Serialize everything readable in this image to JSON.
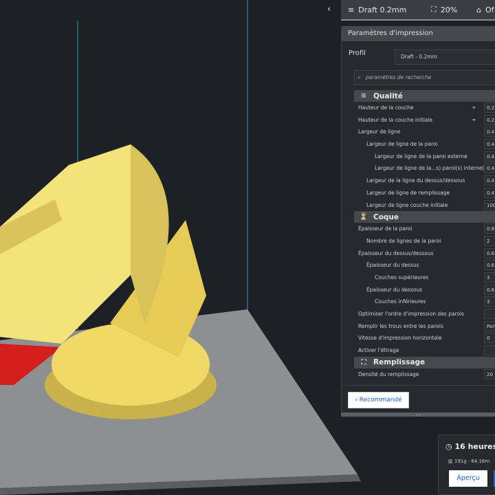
{
  "topbar": {
    "profile": "Draft 0.2mm",
    "infill": "20%",
    "support": "Of",
    "collapse_icon": "chevron-left"
  },
  "panel": {
    "title": "Paramètres d'impression",
    "profile_label": "Profil",
    "profile_value": "Draft - 0.2mm",
    "search_placeholder": "paramètres de recherche",
    "categories": [
      {
        "name": "Qualité",
        "rows": [
          {
            "label": "Hauteur de la couche",
            "value": "0.2",
            "indent": 0,
            "linked": true
          },
          {
            "label": "Hauteur de la couche initiale",
            "value": "0.2",
            "indent": 0,
            "linked": true
          },
          {
            "label": "Largeur de ligne",
            "value": "0.4",
            "indent": 0
          },
          {
            "label": "Largeur de ligne de la paroi",
            "value": "0.4",
            "indent": 1
          },
          {
            "label": "Largeur de ligne de la paroi externe",
            "value": "0.4",
            "indent": 2
          },
          {
            "label": "Largeur de ligne de la...s) paroi(s) interne(s)",
            "value": "0.4",
            "indent": 2
          },
          {
            "label": "Largeur de la ligne du dessus/dessous",
            "value": "0.4",
            "indent": 1
          },
          {
            "label": "Largeur de ligne de remplissage",
            "value": "0.4",
            "indent": 1
          },
          {
            "label": "Largeur de ligne couche initiale",
            "value": "100",
            "indent": 1
          }
        ]
      },
      {
        "name": "Coque",
        "rows": [
          {
            "label": "Épaisseur de la paroi",
            "value": "0.8",
            "indent": 0
          },
          {
            "label": "Nombre de lignes de la paroi",
            "value": "2",
            "indent": 1
          },
          {
            "label": "Épaisseur du dessus/dessous",
            "value": "0.6",
            "indent": 0
          },
          {
            "label": "Épaisseur du dessus",
            "value": "0.6",
            "indent": 1
          },
          {
            "label": "Couches supérieures",
            "value": "3",
            "indent": 2
          },
          {
            "label": "Épaisseur du dessous",
            "value": "0.6",
            "indent": 1
          },
          {
            "label": "Couches inférieures",
            "value": "3",
            "indent": 2
          },
          {
            "label": "Optimiser l'ordre d'impression des parois",
            "value": "",
            "indent": 0
          },
          {
            "label": "Remplir les trous entre les parois",
            "value": "Part",
            "indent": 0
          },
          {
            "label": "Vitesse d'impression horizontale",
            "value": "0",
            "indent": 0
          },
          {
            "label": "Activer l'étirage",
            "value": "",
            "indent": 0
          }
        ]
      },
      {
        "name": "Remplissage",
        "rows": [
          {
            "label": "Densité du remplissage",
            "value": "20",
            "indent": 0
          }
        ]
      }
    ],
    "recommended_button": "Recommandé"
  },
  "estimate": {
    "time": "16 heures",
    "material": "191g · 64.16m",
    "preview_button": "Aperçu"
  },
  "colors": {
    "accent": "#1f66d6",
    "model": "#f4e27a",
    "plate": "#8e8f91"
  }
}
